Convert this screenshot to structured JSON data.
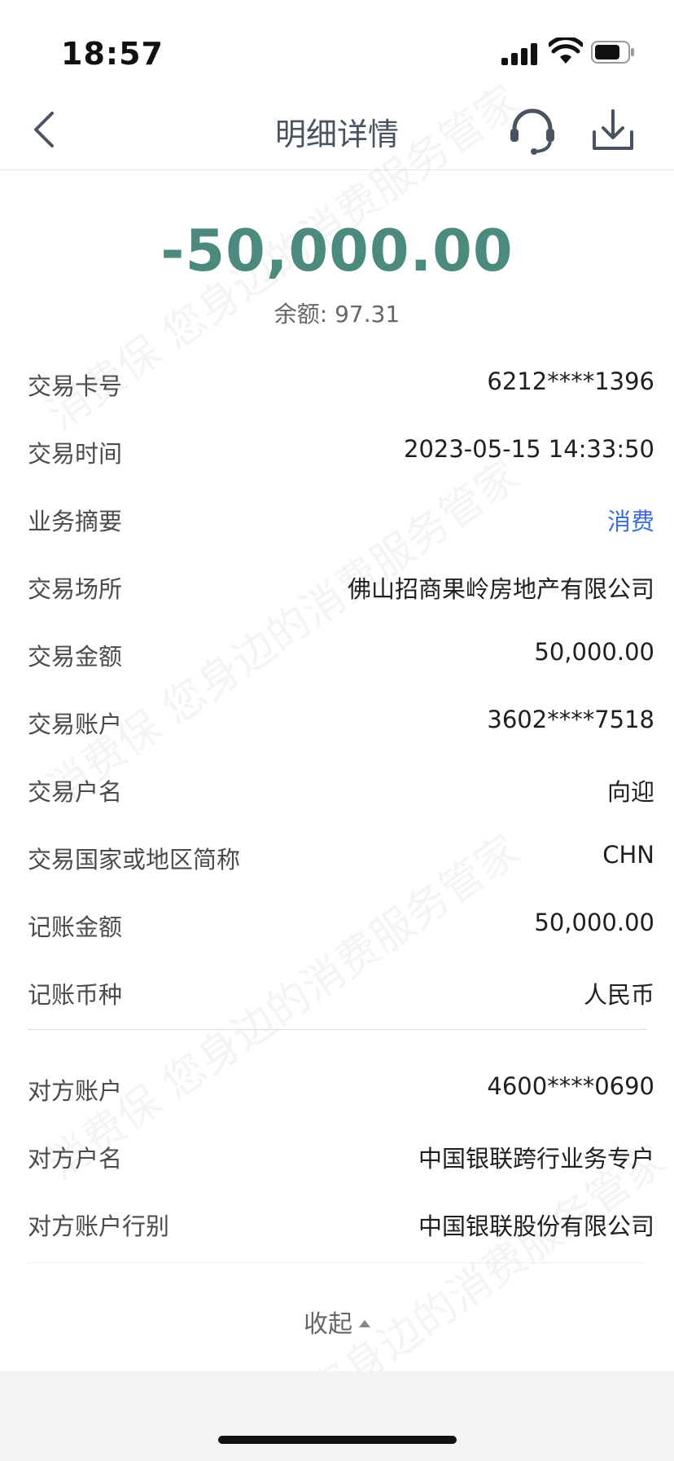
{
  "status_bar": {
    "time": "18:57"
  },
  "nav": {
    "title": "明细详情"
  },
  "summary": {
    "amount": "-50,000.00",
    "balance_label": "余额:",
    "balance_value": "97.31"
  },
  "details": [
    {
      "label": "交易卡号",
      "value": "6212****1396"
    },
    {
      "label": "交易时间",
      "value": "2023-05-15 14:33:50"
    },
    {
      "label": "业务摘要",
      "value": "消费"
    },
    {
      "label": "交易场所",
      "value": "佛山招商果岭房地产有限公司"
    },
    {
      "label": "交易金额",
      "value": "50,000.00"
    },
    {
      "label": "交易账户",
      "value": "3602****7518"
    },
    {
      "label": "交易户名",
      "value": "向迎"
    },
    {
      "label": "交易国家或地区简称",
      "value": "CHN"
    },
    {
      "label": "记账金额",
      "value": "50,000.00"
    },
    {
      "label": "记账币种",
      "value": "人民币"
    }
  ],
  "counterparty": [
    {
      "label": "对方账户",
      "value": "4600****0690"
    },
    {
      "label": "对方户名",
      "value": "中国银联跨行业务专户"
    },
    {
      "label": "对方账户行别",
      "value": "中国银联股份有限公司"
    }
  ],
  "collapse_label": "收起",
  "watermark_text": "消费保 您身边的消费服务管家",
  "colors": {
    "amount": "#4b8a7c",
    "link": "#3b6ed6"
  }
}
